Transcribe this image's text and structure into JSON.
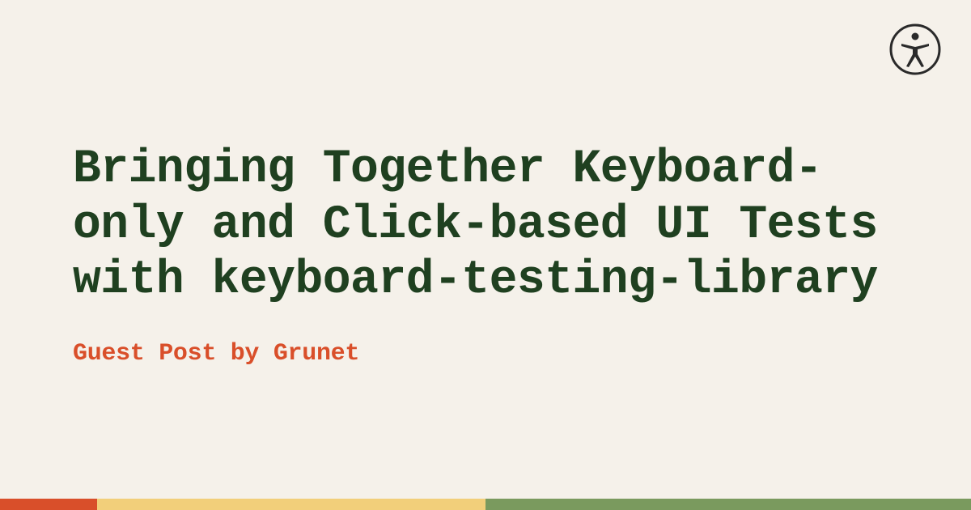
{
  "title": "Bringing Together Keyboard-only and Click-based UI Tests with keyboard-testing-library",
  "subtitle": "Guest Post by Grunet",
  "colors": {
    "background": "#f5f1ea",
    "title": "#1f4020",
    "subtitle": "#d94f2a",
    "iconStroke": "#2a2a2a",
    "stripe1": "#d94f2a",
    "stripe2": "#f2cf7a",
    "stripe3": "#7a9a5e"
  }
}
